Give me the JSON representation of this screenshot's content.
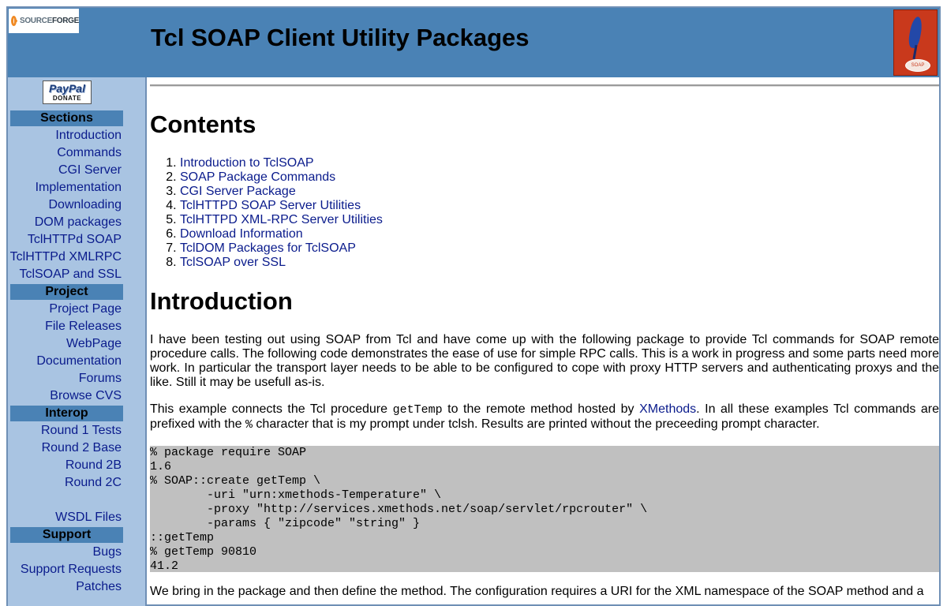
{
  "header": {
    "logo_text_1": "SOURCE",
    "logo_text_2": "FORGE",
    "title": "Tcl SOAP Client Utility Packages",
    "tcl_badge": "SOAP"
  },
  "sidebar": {
    "paypal": {
      "word": "PayPal",
      "donate": "DONATE"
    },
    "sections": [
      {
        "title": "Sections",
        "items": [
          "Introduction",
          "Commands",
          "CGI Server",
          "Implementation",
          "Downloading",
          "DOM packages",
          "TclHTTPd SOAP",
          "TclHTTPd XMLRPC",
          "TclSOAP and SSL"
        ]
      },
      {
        "title": "Project",
        "items": [
          "Project Page",
          "File Releases",
          "WebPage",
          "Documentation",
          "Forums",
          "Browse CVS"
        ]
      },
      {
        "title": "Interop",
        "items": [
          "Round 1 Tests",
          "Round 2 Base",
          "Round 2B",
          "Round 2C",
          "",
          "WSDL Files"
        ]
      },
      {
        "title": "Support",
        "items": [
          "Bugs",
          "Support Requests",
          "Patches"
        ]
      }
    ]
  },
  "main": {
    "contents_heading": "Contents",
    "toc": [
      "Introduction to TclSOAP",
      "SOAP Package Commands",
      "CGI Server Package",
      "TclHTTPD SOAP Server Utilities",
      "TclHTTPD XML-RPC Server Utilities",
      "Download Information",
      "TclDOM Packages for TclSOAP",
      "TclSOAP over SSL"
    ],
    "intro_heading": "Introduction",
    "intro_para": "I have been testing out using SOAP from Tcl and have come up with the following package to provide Tcl commands for SOAP remote procedure calls. The following code demonstrates the ease of use for simple RPC calls. This is a work in progress and some parts need more work. In particular the transport layer needs to be able to be configured to cope with proxy HTTP servers and authenticating proxys and the like. Still it may be usefull as-is.",
    "example_para": {
      "part1": "This example connects the Tcl procedure ",
      "code1": "getTemp",
      "part2": " to the remote method hosted by ",
      "link": "XMethods",
      "part3": ". In all these examples Tcl commands are prefixed with the ",
      "code2": "%",
      "part4": " character that is my prompt under tclsh. Results are printed without the preceeding prompt character."
    },
    "code_block": "% package require SOAP\n1.6\n% SOAP::create getTemp \\\n        -uri \"urn:xmethods-Temperature\" \\\n        -proxy \"http://services.xmethods.net/soap/servlet/rpcrouter\" \\\n        -params { \"zipcode\" \"string\" }\n::getTemp\n% getTemp 90810\n41.2",
    "bottom_para": "We bring in the package and then define the method. The configuration requires a URI for the XML namespace of the SOAP method and a"
  }
}
